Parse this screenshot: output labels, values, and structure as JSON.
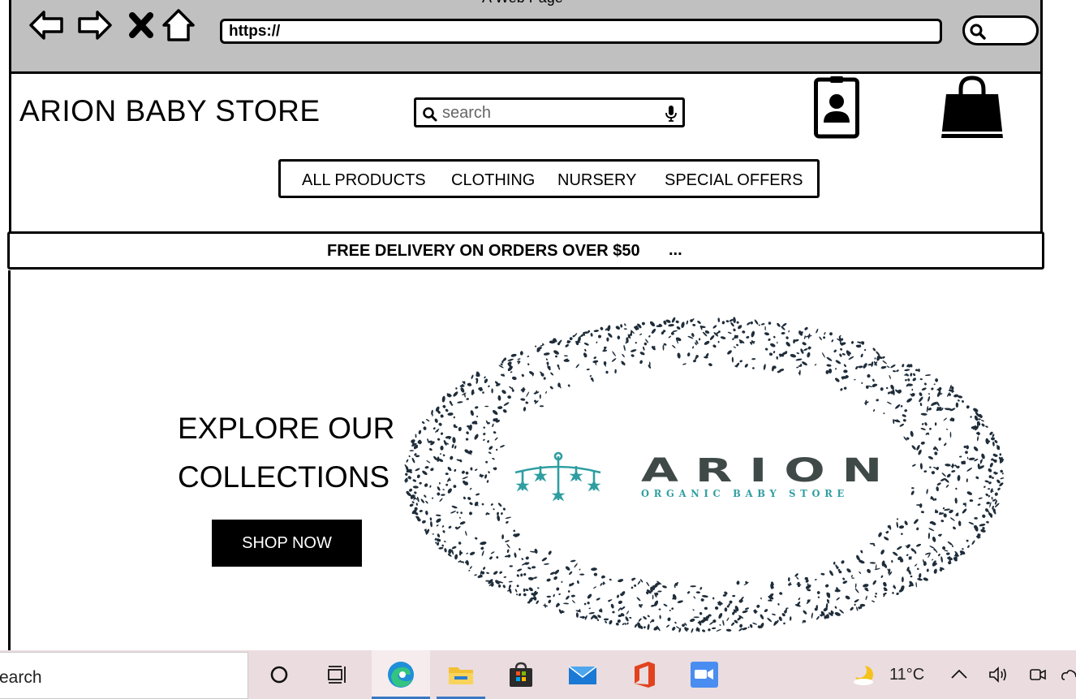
{
  "browser": {
    "window_title": "A Web Page",
    "url": "https://"
  },
  "header": {
    "brand": "ARION BABY STORE",
    "search_placeholder": "search"
  },
  "menu": {
    "items": [
      {
        "label": "ALL PRODUCTS"
      },
      {
        "label": "CLOTHING"
      },
      {
        "label": "NURSERY"
      },
      {
        "label": "SPECIAL OFFERS"
      }
    ]
  },
  "promo": {
    "text": "FREE DELIVERY ON ORDERS OVER $50",
    "more": "..."
  },
  "hero": {
    "line1": "EXPLORE OUR",
    "line2": "COLLECTIONS",
    "button": "SHOP NOW"
  },
  "logo": {
    "name": "ARION",
    "tagline": "ORGANIC BABY STORE",
    "text_color": "#3f4a48",
    "accent_color": "#2f9ea1",
    "speckle_color": "#1f2d3a"
  },
  "taskbar": {
    "search_text": "earch",
    "temperature": "11°C",
    "active_color": "#3a78c4"
  }
}
